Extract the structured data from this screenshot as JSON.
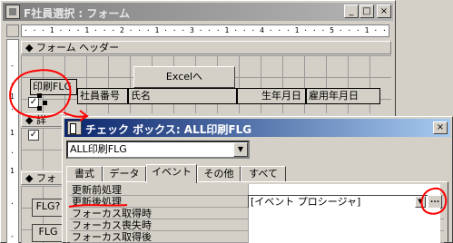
{
  "window": {
    "title": "F社員選択 : フォーム",
    "minimize": "_",
    "maximize": "□",
    "close": "×"
  },
  "ruler": {
    "horizontal": "· · · 1 · · · 1 · · · 2 · · · 1 · · · 3 · · · 1 · · · 4 · · · 1 · · · 5 · · · 1 · · · 6 · · · 1 · · · 7 · · · 1 · · · 8 · · · 1 · · · 9 · · · 1 · · · 10",
    "vertical": [
      "-",
      "·",
      "1",
      "·",
      "1",
      "·",
      "1",
      "·",
      "-"
    ]
  },
  "form": {
    "header_section": "フォーム ヘッダー",
    "detail_section": "詳",
    "footer_section": "フォ",
    "excel_button": "Excelへ",
    "label_print_flg": "印刷FLG",
    "label_emp_no": "社員番号",
    "label_name": "氏名",
    "label_birth": "生年月日",
    "label_hire": "雇用年月日",
    "flg_button_1": "FLG?",
    "flg_button_2": "FLG"
  },
  "property_sheet": {
    "title": "チェック ボックス: ALL印刷FLG",
    "object_combo_value": "ALL印刷FLG",
    "close": "×",
    "tabs": [
      "書式",
      "データ",
      "イベント",
      "その他",
      "すべて"
    ],
    "active_tab": "イベント",
    "rows": [
      {
        "name": "更新前処理",
        "value": ""
      },
      {
        "name": "更新後処理",
        "value": "[イベント プロシージャ]"
      },
      {
        "name": "フォーカス取得時",
        "value": ""
      },
      {
        "name": "フォーカス喪失時",
        "value": ""
      },
      {
        "name": "フォーカス取得後",
        "value": ""
      }
    ],
    "builder_button": "..."
  },
  "annotations": {
    "color": "#ff0000"
  }
}
